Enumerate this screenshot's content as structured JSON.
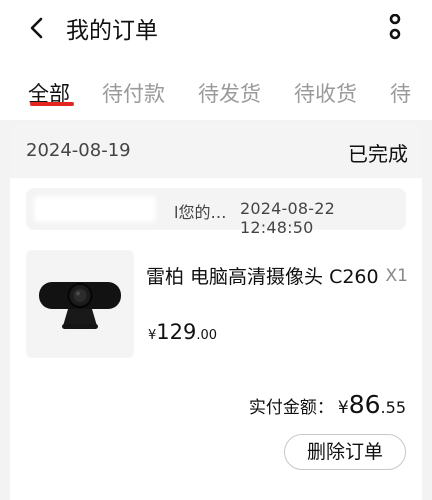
{
  "header": {
    "title": "我的订单",
    "back_icon": "back-arrow-icon",
    "more_icon": "more-vertical-icon"
  },
  "tabs": [
    {
      "label": "全部",
      "active": true
    },
    {
      "label": "待付款",
      "active": false
    },
    {
      "label": "待发货",
      "active": false
    },
    {
      "label": "待收货",
      "active": false
    },
    {
      "label": "待",
      "active": false
    }
  ],
  "colors": {
    "accent": "#e3261e",
    "tab_inactive": "#9a9a9a",
    "background": "#f3f3f3"
  },
  "order": {
    "date": "2024-08-19",
    "status": "已完成",
    "message": {
      "text": "l您的…",
      "time": "2024-08-22  12:48:50"
    },
    "product": {
      "name": "雷柏 电脑高清摄像头 C260",
      "quantity": "X1",
      "price_symbol": "¥",
      "price_int": "129",
      "price_dec": ".00",
      "thumb_label": "rapoo"
    },
    "paid": {
      "label": "实付金额：",
      "symbol": "¥",
      "int": "86",
      "dec": ".55"
    },
    "delete_label": "删除订单"
  }
}
